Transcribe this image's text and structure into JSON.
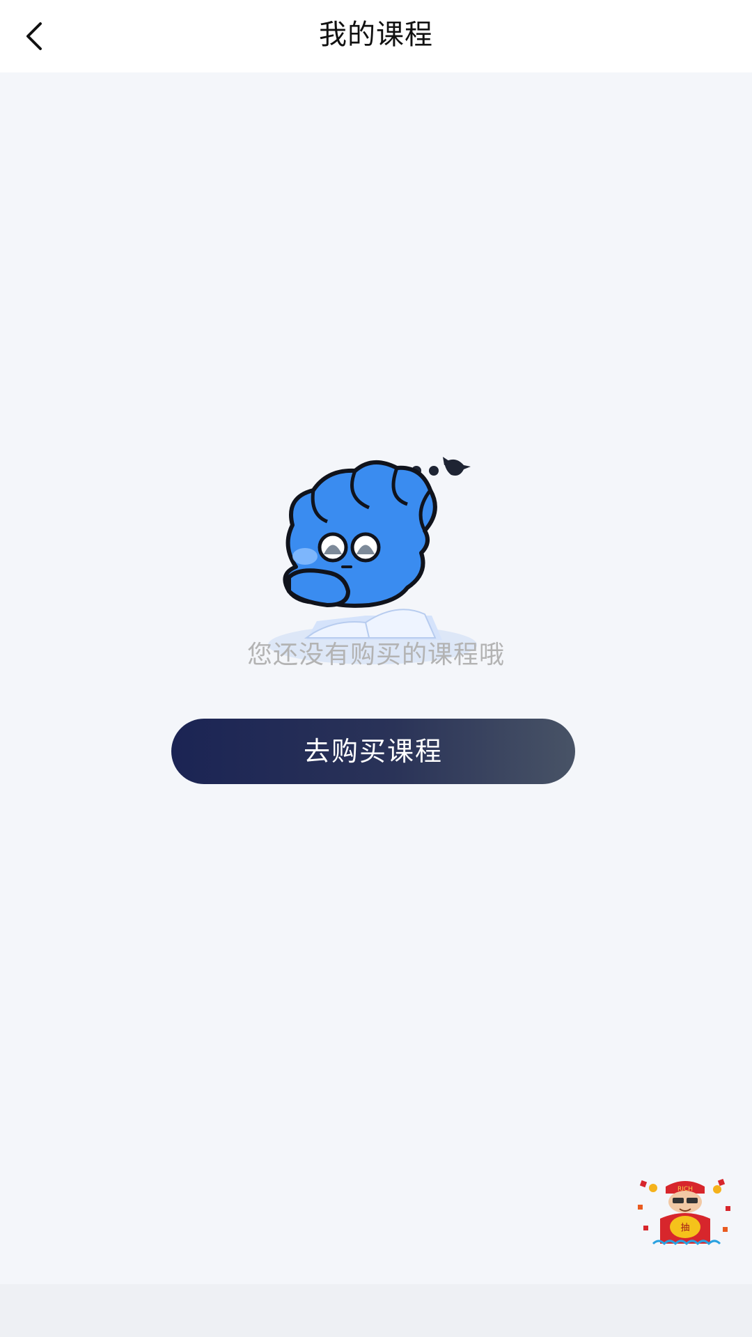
{
  "header": {
    "title": "我的课程",
    "back_icon": "chevron-left-icon"
  },
  "empty_state": {
    "illustration": "sleepy-blue-mascot-reading-book",
    "message": "您还没有购买的课程哦"
  },
  "actions": {
    "buy_course_label": "去购买课程"
  },
  "floating_badge": {
    "icon": "lucky-draw-mascot-icon",
    "hat_text": "RICH",
    "bag_text": "抽"
  },
  "colors": {
    "header_bg": "#ffffff",
    "page_bg": "#f4f6fa",
    "title_text": "#111111",
    "empty_text": "#b3b3b3",
    "button_gradient_start": "#1b2454",
    "button_gradient_end": "#485366",
    "mascot_blue": "#3a8cf0"
  }
}
